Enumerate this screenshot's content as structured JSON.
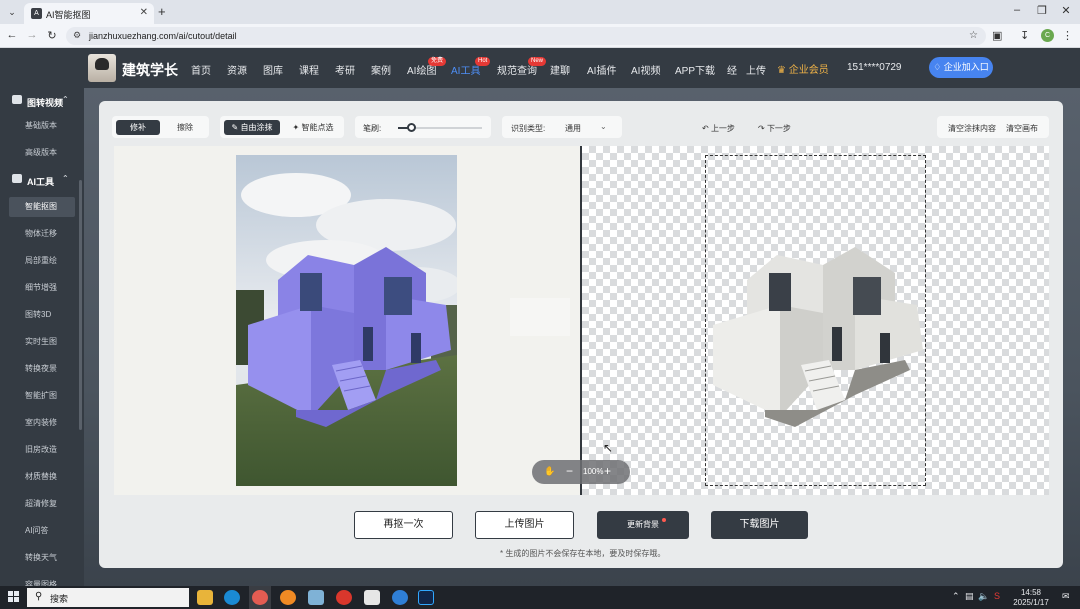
{
  "browser": {
    "tab_title": "AI智能抠图",
    "url": "jianzhuxuezhang.com/ai/cutout/detail"
  },
  "header": {
    "logo_text": "建筑学长",
    "nav": [
      {
        "label": "首页"
      },
      {
        "label": "资源"
      },
      {
        "label": "图库"
      },
      {
        "label": "课程"
      },
      {
        "label": "考研"
      },
      {
        "label": "案例"
      },
      {
        "label": "AI绘图",
        "badge": "免费"
      },
      {
        "label": "AI工具",
        "badge": "Hot",
        "active": true
      },
      {
        "label": "规范查询",
        "badge": "New"
      },
      {
        "label": "建聊"
      },
      {
        "label": "AI插件"
      },
      {
        "label": "AI视频"
      },
      {
        "label": "APP下载"
      },
      {
        "label": "经"
      }
    ],
    "upload": "上传",
    "vip": "企业会员",
    "phone": "151****0729",
    "join": "企业加入口"
  },
  "sidebar": {
    "groups": [
      {
        "label": "图转视频",
        "items": [
          "基础版本",
          "高级版本"
        ]
      },
      {
        "label": "AI工具",
        "items": [
          "智能抠图",
          "物体迁移",
          "局部重绘",
          "细节增强",
          "图转3D",
          "实时生图",
          "转换夜景",
          "智能扩图",
          "室内装修",
          "旧房改造",
          "材质替换",
          "超清修复",
          "AI问答",
          "转换天气",
          "容量图格"
        ]
      }
    ],
    "active_item": "智能抠图"
  },
  "toolbar": {
    "mode_repair": "修补",
    "mode_erase": "擦除",
    "brush_free": "自由涂抹",
    "brush_smart": "智能点选",
    "stroke_label": "笔刷:",
    "stroke_value": 0.15,
    "detect_label": "识别类型:",
    "detect_value": "通用",
    "undo": "上一步",
    "redo": "下一步",
    "clear_strokes": "清空涂抹内容",
    "clear_canvas": "清空画布"
  },
  "canvas": {
    "zoom": "100%"
  },
  "actions": {
    "retry": "再抠一次",
    "upload": "上传图片",
    "change_bg": "更新背景",
    "download": "下载图片"
  },
  "note": "* 生成的图片不会保存在本地，要及时保存哦。",
  "taskbar": {
    "search": "搜索",
    "time": "14:58",
    "date": "2025/1/17"
  },
  "colors": {
    "dark": "#343b43",
    "accent": "#4784f0",
    "vip": "#f0b347",
    "mask": "#7f79e0"
  }
}
